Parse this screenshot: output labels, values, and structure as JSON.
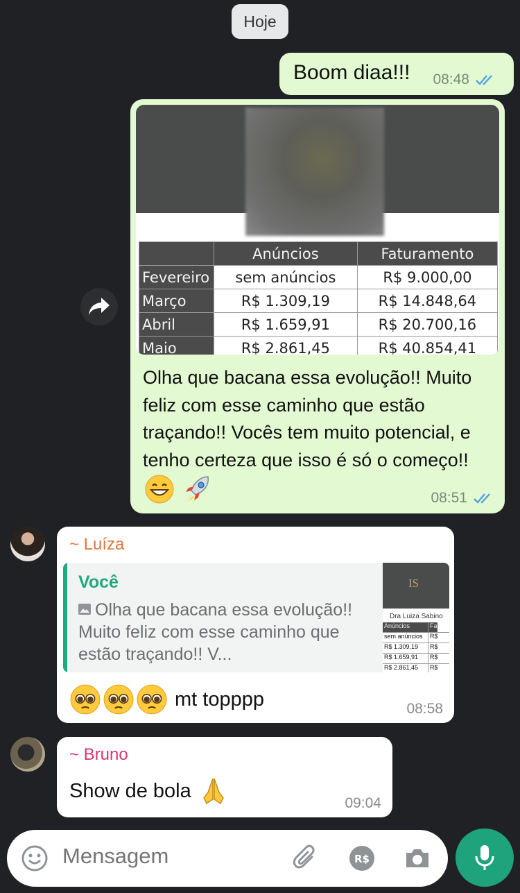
{
  "date_chip": "Hoje",
  "messages": {
    "m1": {
      "text": "Boom diaa!!!",
      "time": "08:48"
    },
    "m2": {
      "table": {
        "headers": [
          "",
          "Anúncios",
          "Faturamento"
        ],
        "rows": [
          {
            "month": "Fevereiro",
            "ads": "sem anúncios",
            "revenue": "R$ 9.000,00"
          },
          {
            "month": "Março",
            "ads": "R$ 1.309,19",
            "revenue": "R$ 14.848,64"
          },
          {
            "month": "Abril",
            "ads": "R$ 1.659,91",
            "revenue": "R$ 20.700,16"
          },
          {
            "month": "Maio",
            "ads": "R$ 2.861,45",
            "revenue": "R$ 40.854,41"
          }
        ]
      },
      "caption": "Olha que bacana essa evolução!! Muito feliz com esse caminho que estão traçando!! Vocês tem muito potencial, e tenho certeza que isso é só o começo!!",
      "time": "08:51"
    },
    "m3": {
      "sender": "~ Luíza",
      "quote_author": "Você",
      "quote_text": "Olha que bacana essa evolução!! Muito feliz com esse caminho que estão traçando!! V...",
      "quote_thumb": {
        "logo": "IS",
        "name": "Dra Luiza Sabino",
        "header": [
          "Anúncios",
          "Fa"
        ],
        "rows": [
          [
            "sem anúncios",
            "R$"
          ],
          [
            "R$ 1.309,19",
            "R$"
          ],
          [
            "R$ 1.659,91",
            "R$"
          ],
          [
            "R$ 2.861,45",
            "R$"
          ]
        ]
      },
      "text": "mt topppp",
      "time": "08:58"
    },
    "m4": {
      "sender": "~ Bruno",
      "text": "Show de bola",
      "time": "09:04"
    }
  },
  "input": {
    "placeholder": "Mensagem"
  },
  "icons": {
    "emoji": "emoji-icon",
    "attach": "paperclip-icon",
    "payment": "payment-icon",
    "camera": "camera-icon",
    "mic": "mic-icon",
    "forward": "forward-icon",
    "read": "double-check-icon"
  },
  "colors": {
    "background": "#1f2124",
    "outgoing": "#e2f9d2",
    "incoming": "#ffffff",
    "accent": "#1ea37c",
    "luiza": "#e0763d",
    "bruno": "#d9366e",
    "read_ticks": "#4fa3e0"
  }
}
